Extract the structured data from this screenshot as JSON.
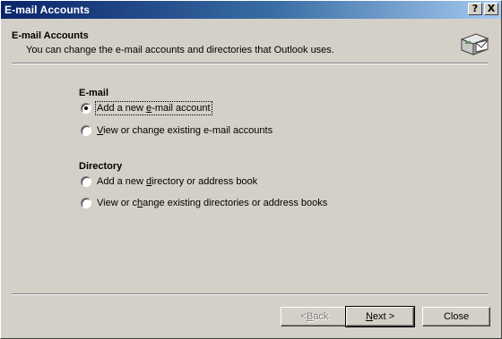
{
  "window": {
    "title": "E-mail Accounts",
    "help_glyph": "?",
    "close_glyph": "X"
  },
  "header": {
    "title": "E-mail Accounts",
    "subtitle": "You can change the e-mail accounts and directories that Outlook uses.",
    "icon": "email-accounts-icon"
  },
  "email_section": {
    "title": "E-mail",
    "options": [
      {
        "pre": "Add a new ",
        "key": "e",
        "post": "-mail account",
        "checked": true
      },
      {
        "pre": "",
        "key": "V",
        "post": "iew or change existing e-mail accounts",
        "checked": false
      }
    ]
  },
  "directory_section": {
    "title": "Directory",
    "options": [
      {
        "pre": "Add a new ",
        "key": "d",
        "post": "irectory or address book",
        "checked": false
      },
      {
        "pre": "View or c",
        "key": "h",
        "post": "ange existing directories or address books",
        "checked": false
      }
    ]
  },
  "buttons": {
    "back": {
      "pre": "< ",
      "key": "B",
      "post": "ack",
      "enabled": false
    },
    "next": {
      "pre": "",
      "key": "N",
      "post": "ext >",
      "enabled": true
    },
    "close": {
      "pre": "",
      "key": "",
      "post": "Close",
      "enabled": true
    }
  }
}
